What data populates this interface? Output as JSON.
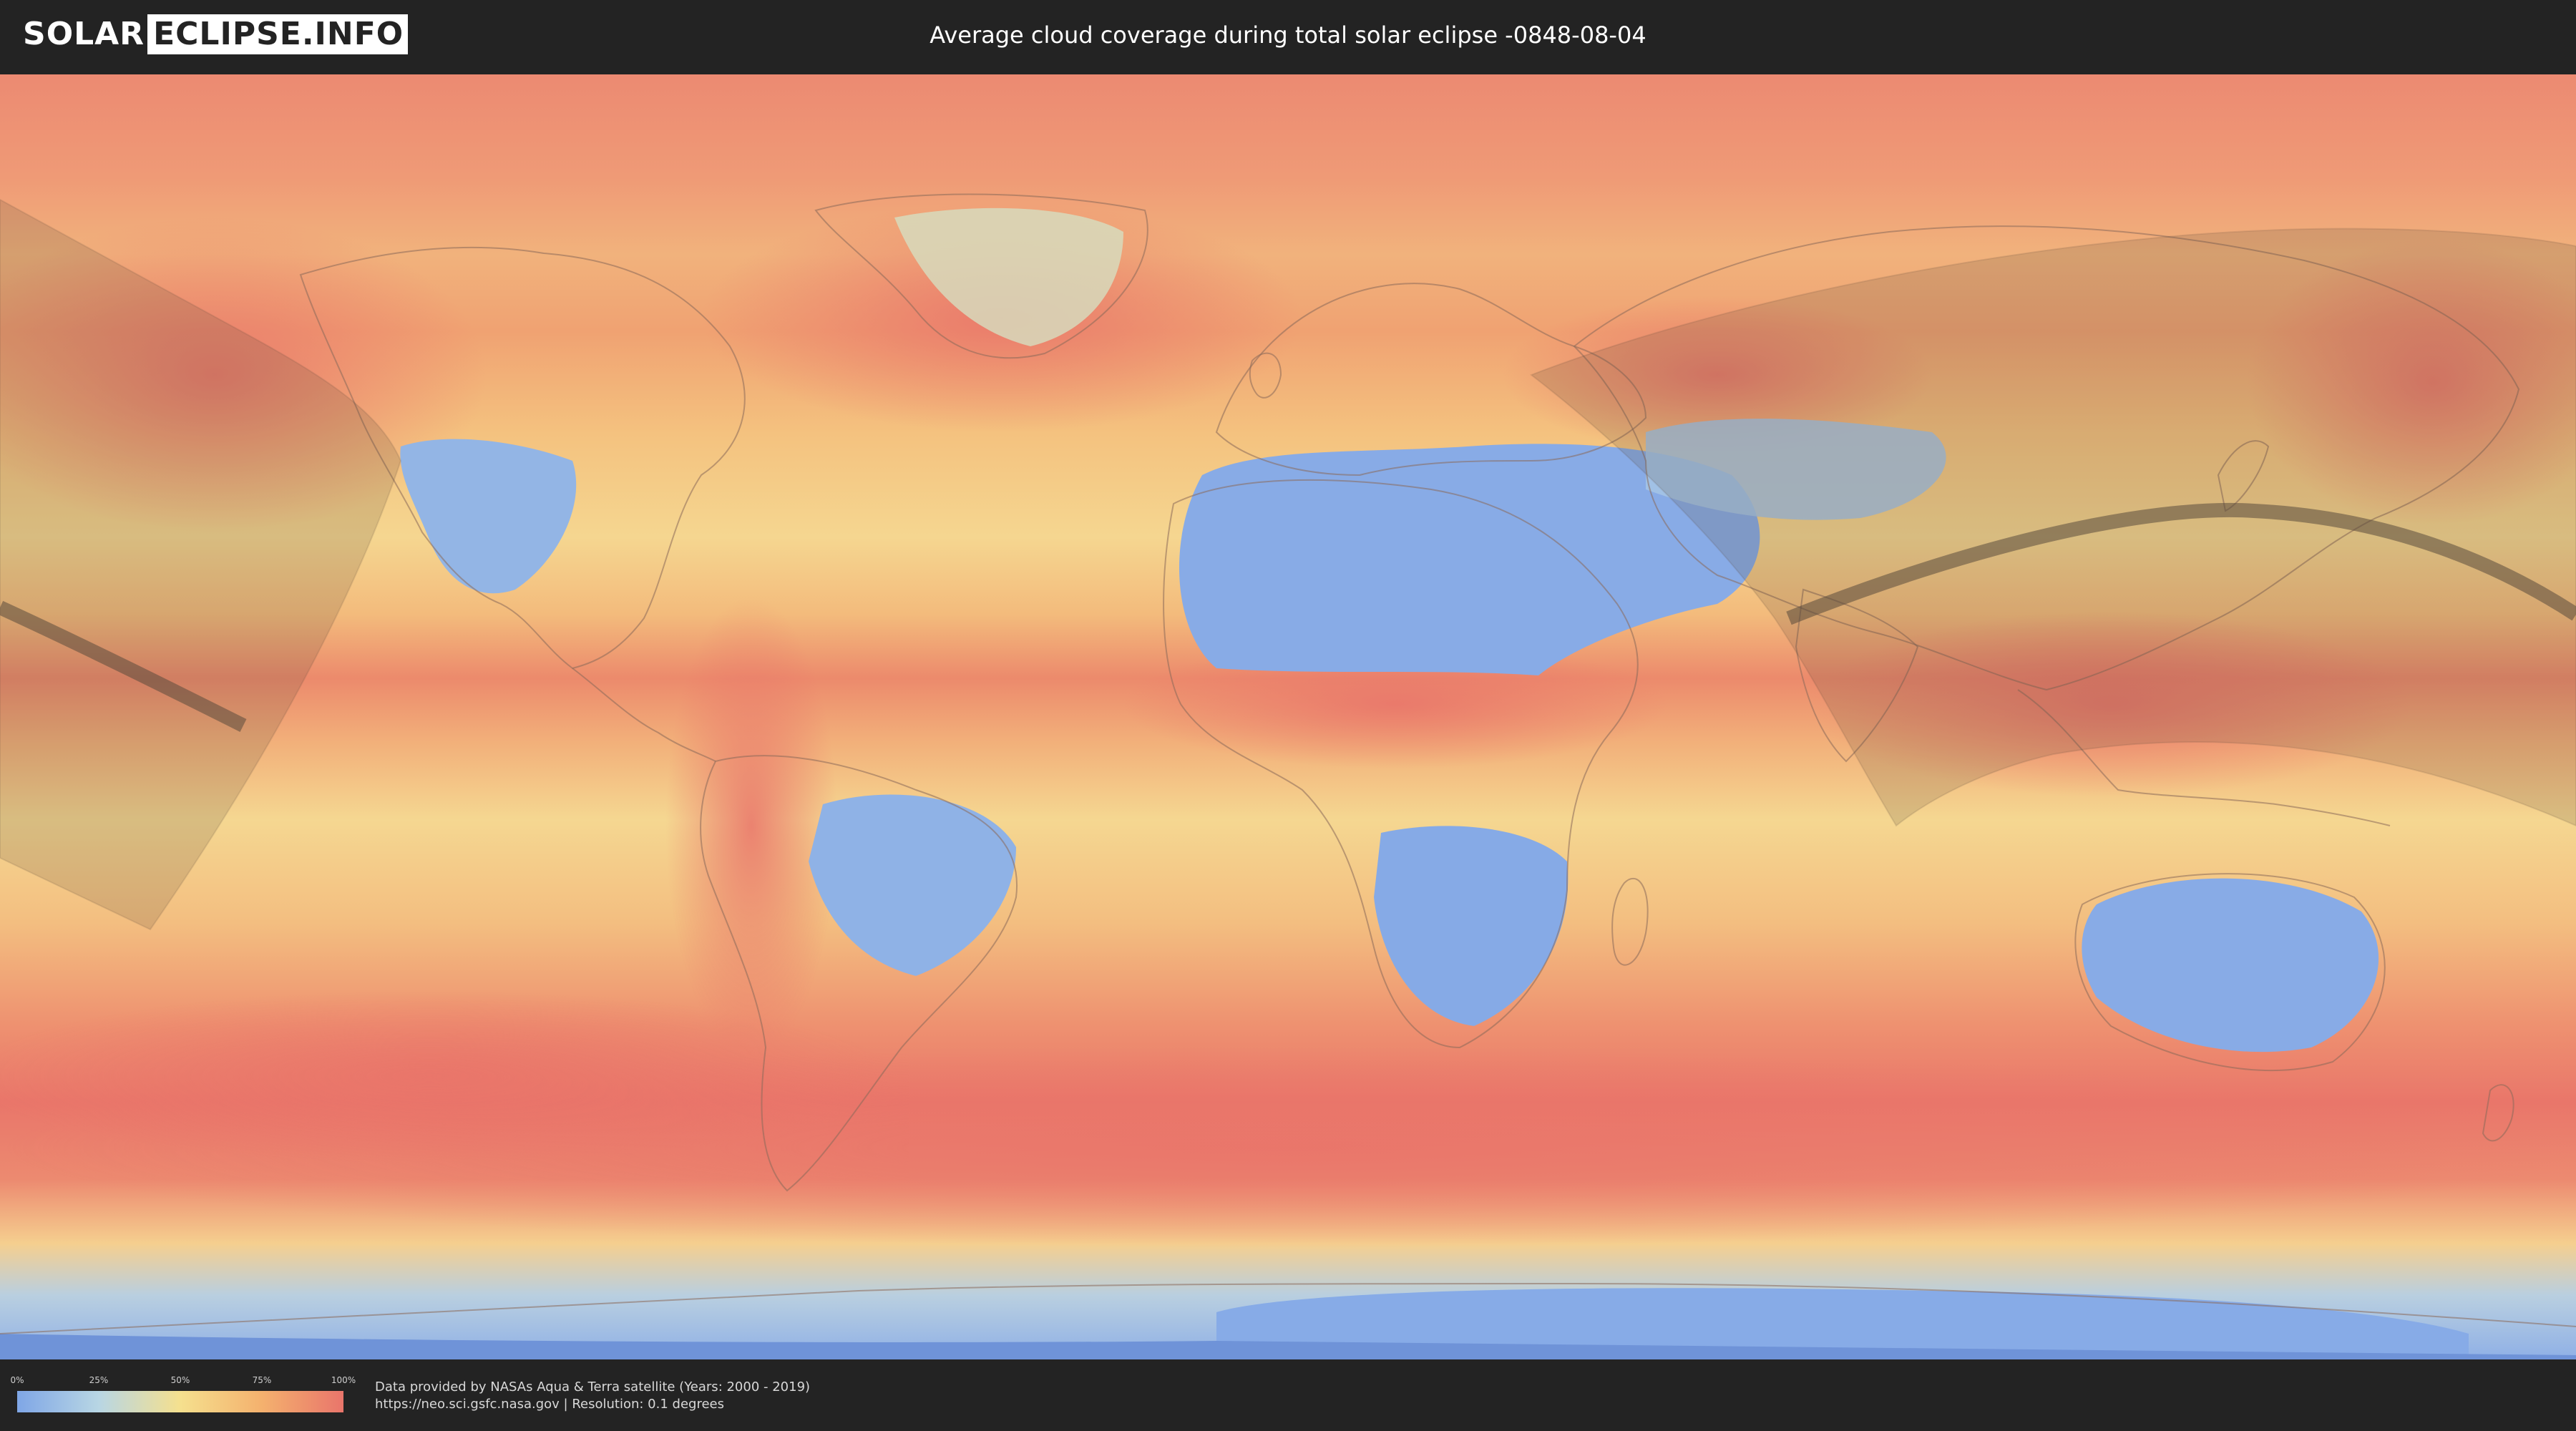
{
  "header": {
    "logo_left": "SOLAR",
    "logo_right": "ECLIPSE.INFO",
    "title": "Average cloud coverage during total solar eclipse -0848-08-04"
  },
  "legend": {
    "ticks": [
      "0%",
      "25%",
      "50%",
      "75%",
      "100%"
    ],
    "colors": [
      "#7fa6e6",
      "#b8d6e4",
      "#f5e08e",
      "#f4b16e",
      "#e9756b"
    ]
  },
  "credits": {
    "line1": "Data provided by NASAs Aqua & Terra satellite (Years: 2000 - 2019)",
    "line2": "https://neo.sci.gsfc.nasa.gov | Resolution: 0.1 degrees"
  },
  "map": {
    "projection": "equirectangular",
    "layers": [
      "cloud-coverage",
      "country-borders",
      "eclipse-visibility-zone",
      "totality-path"
    ]
  }
}
